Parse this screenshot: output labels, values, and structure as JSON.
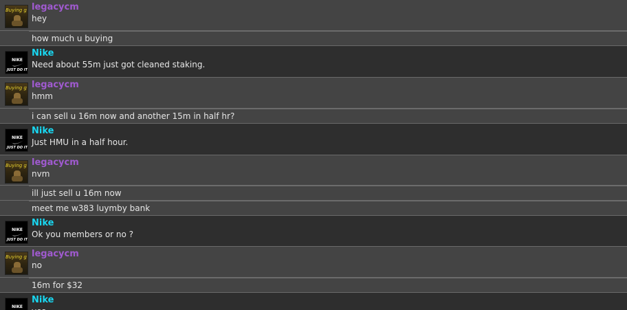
{
  "users": {
    "legacy": {
      "name": "legacycm",
      "avatar_text": "Buying g",
      "color": "#a05ad0"
    },
    "nike": {
      "name": "Nike",
      "avatar_text": "NIKE JUST DO IT",
      "color": "#19d6f0"
    }
  },
  "messages": [
    {
      "user": "legacycm",
      "lines": [
        "hey"
      ]
    },
    {
      "user": "legacycm",
      "lines": [
        "how much u buying"
      ]
    },
    {
      "user": "Nike",
      "lines": [
        "Need about 55m just got cleaned staking."
      ]
    },
    {
      "user": "legacycm",
      "lines": [
        "hmm"
      ]
    },
    {
      "user": "legacycm",
      "lines": [
        "i can sell u 16m now and another 15m in half hr?"
      ]
    },
    {
      "user": "Nike",
      "lines": [
        "Just HMU in a half hour."
      ]
    },
    {
      "user": "legacycm",
      "lines": [
        "nvm"
      ]
    },
    {
      "user": "legacycm",
      "lines": [
        "ill just sell u 16m now"
      ]
    },
    {
      "user": "legacycm",
      "lines": [
        "meet me w383 luymby bank"
      ]
    },
    {
      "user": "Nike",
      "lines": [
        "Ok you members or no ?"
      ]
    },
    {
      "user": "legacycm",
      "lines": [
        "no"
      ]
    },
    {
      "user": "legacycm",
      "lines": [
        "16m for $32"
      ]
    },
    {
      "user": "Nike",
      "lines": [
        "yea"
      ]
    }
  ]
}
